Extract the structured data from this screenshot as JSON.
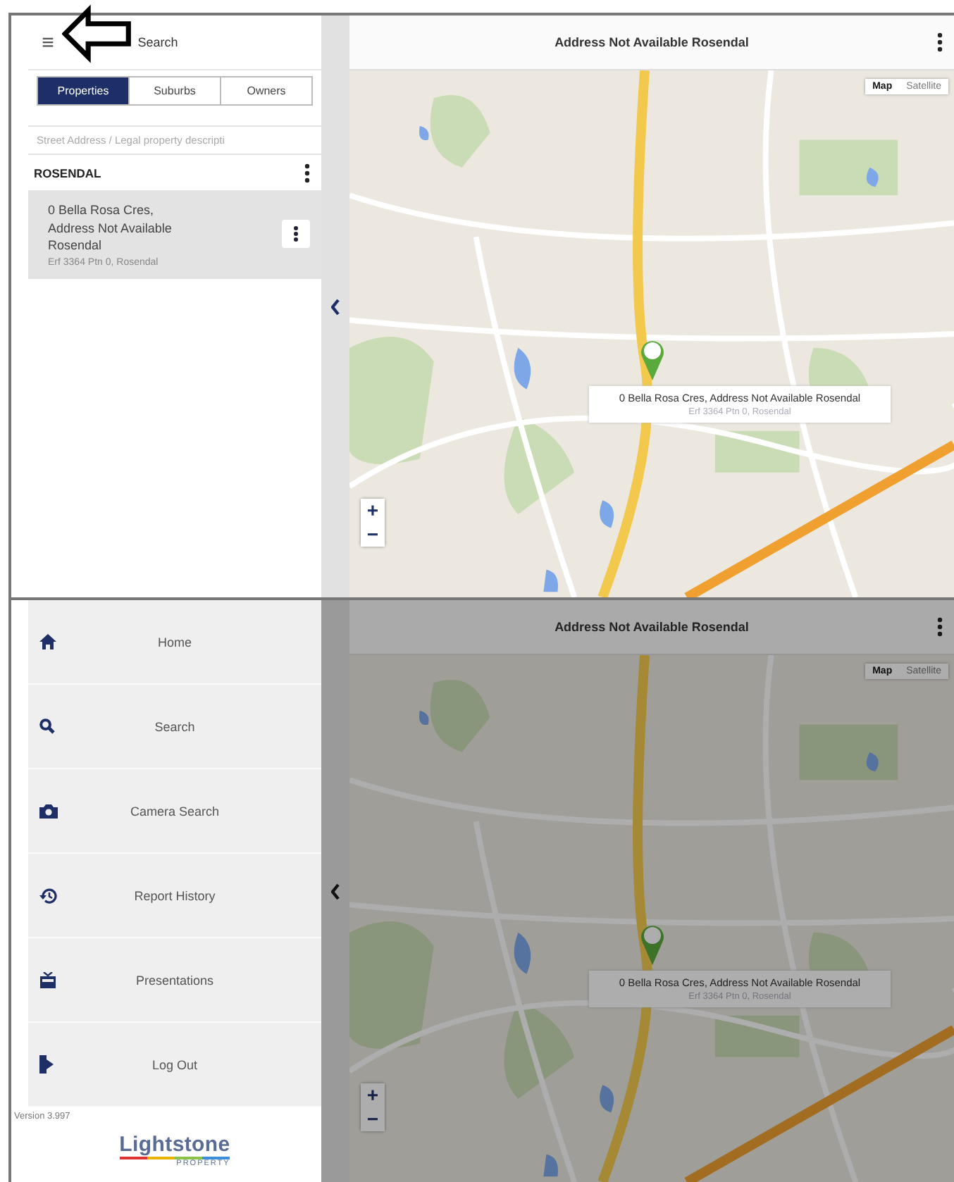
{
  "search_screen": {
    "header": {
      "menu_glyph": "≡",
      "title": "Search"
    },
    "tabs": [
      {
        "label": "Properties",
        "selected": true
      },
      {
        "label": "Suburbs",
        "selected": false
      },
      {
        "label": "Owners",
        "selected": false
      }
    ],
    "search": {
      "placeholder": "Street Address / Legal property descripti"
    },
    "group": {
      "label": "ROSENDAL"
    },
    "results": [
      {
        "lines": [
          "0 Bella Rosa Cres,",
          "Address Not Available",
          "Rosendal"
        ],
        "detail": "Erf 3364 Ptn 0, Rosendal",
        "selected": true
      }
    ],
    "map": {
      "title": "Address Not Available Rosendal",
      "popup_title": "0 Bella Rosa Cres, Address Not Available Rosendal",
      "popup_detail": "Erf 3364 Ptn 0, Rosendal",
      "map_types": [
        {
          "label": "Map",
          "selected": true
        },
        {
          "label": "Satellite",
          "selected": false
        }
      ],
      "zoom": [
        "+",
        "−"
      ],
      "dimmed": false
    }
  },
  "menu_screen": {
    "items": [
      {
        "kind": "home",
        "label": "Home"
      },
      {
        "kind": "search",
        "label": "Search"
      },
      {
        "kind": "camera",
        "label": "Camera Search"
      },
      {
        "kind": "history",
        "label": "Report History"
      },
      {
        "kind": "presentations",
        "label": "Presentations"
      },
      {
        "kind": "logout",
        "label": "Log Out"
      }
    ],
    "version": "Version 3.997",
    "logo": {
      "name": "Lightstone",
      "tagline": "PROPERTY"
    },
    "map": {
      "title": "Address Not Available Rosendal",
      "popup_title": "0 Bella Rosa Cres, Address Not Available Rosendal",
      "popup_detail": "Erf 3364 Ptn 0, Rosendal",
      "map_types": [
        {
          "label": "Map",
          "selected": true
        },
        {
          "label": "Satellite",
          "selected": false
        }
      ],
      "zoom": [
        "+",
        "−"
      ],
      "dimmed": true
    }
  }
}
